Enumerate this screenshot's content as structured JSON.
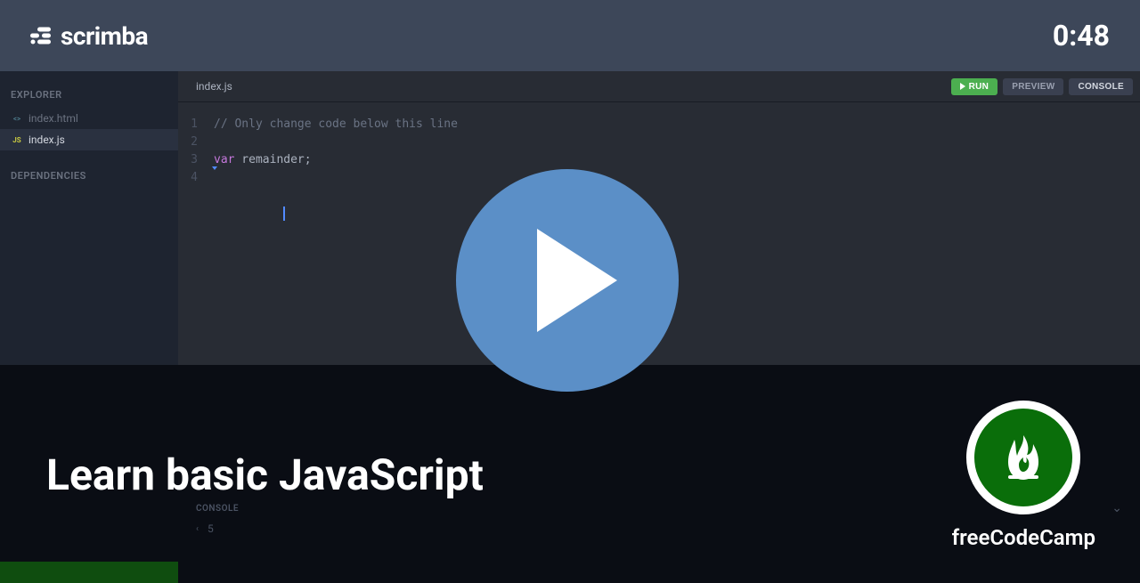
{
  "header": {
    "brand": "scrimba",
    "timer": "0:48"
  },
  "sidebar": {
    "explorer_title": "EXPLORER",
    "dependencies_title": "DEPENDENCIES",
    "files": [
      {
        "name": "index.html",
        "type": "html",
        "active": false
      },
      {
        "name": "index.js",
        "type": "js",
        "active": true
      }
    ]
  },
  "editor": {
    "tab": "index.js",
    "buttons": {
      "run": "RUN",
      "preview": "PREVIEW",
      "console": "CONSOLE"
    },
    "lines": [
      {
        "num": "1",
        "type": "comment",
        "text": "// Only change code below this line"
      },
      {
        "num": "2",
        "type": "empty",
        "text": ""
      },
      {
        "num": "3",
        "type": "declaration",
        "keyword": "var",
        "rest": " remainder;"
      },
      {
        "num": "4",
        "type": "cursor",
        "text": ""
      }
    ]
  },
  "console": {
    "title": "CONSOLE",
    "output": "5"
  },
  "overlay": {
    "title": "Learn basic JavaScript",
    "author": "freeCodeCamp"
  }
}
